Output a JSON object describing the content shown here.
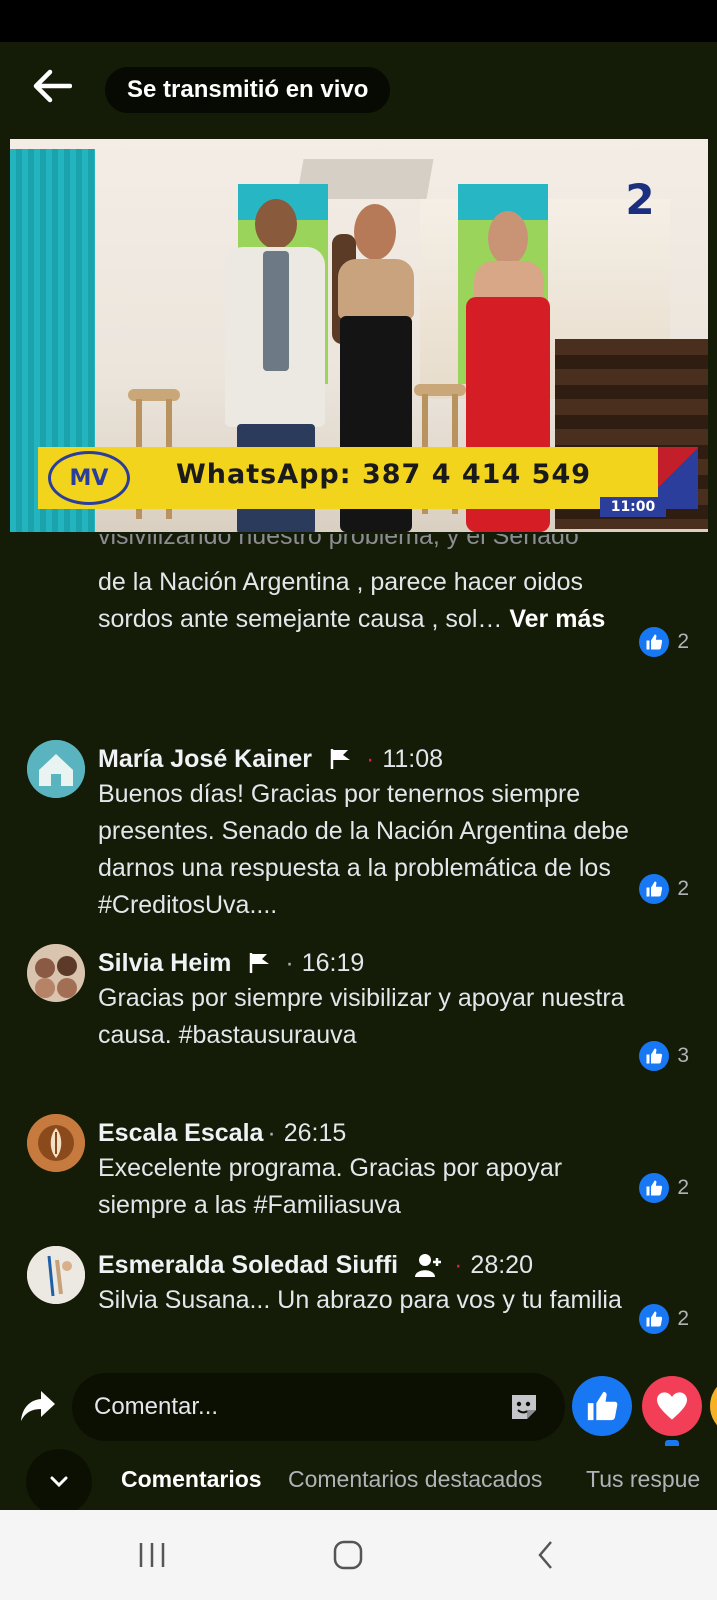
{
  "header": {
    "live_label": "Se transmitió en vivo"
  },
  "video": {
    "banner_logo": "MV",
    "banner_text": "WhatsApp: 387 4 414 549",
    "clock": "11:00",
    "channel": "2"
  },
  "comments": [
    {
      "name": "",
      "time": "",
      "text_faded": "visivilizando nuestro problema, y el Senado",
      "text": "de la Nación Argentina , parece hacer oidos sordos ante semejante causa , sol…",
      "more": "Ver más",
      "likes": "2"
    },
    {
      "name": "María José Kainer",
      "time": "11:08",
      "badge": "flag-icon",
      "text": "Buenos días! Gracias por tenernos siempre presentes. Senado de la Nación Argentina debe darnos una respuesta a la problemática de los #CreditosUva....",
      "likes": "2"
    },
    {
      "name": "Silvia Heim",
      "time": "16:19",
      "badge": "flag-icon",
      "text": "Gracias por siempre visibilizar y apoyar nuestra causa. #bastausurauva",
      "likes": "3"
    },
    {
      "name": "Escala Escala",
      "time": "26:15",
      "text": "Execelente programa. Gracias por apoyar siempre  a las #Familiasuva",
      "likes": "2"
    },
    {
      "name": "Esmeralda Soledad Siuffi",
      "time": "28:20",
      "badge": "new-member-icon",
      "text": "Silvia Susana... Un abrazo para vos y tu familia",
      "likes": "2"
    }
  ],
  "composer": {
    "placeholder": "Comentar..."
  },
  "tabs": [
    {
      "label": "Comentarios",
      "active": true
    },
    {
      "label": "Comentarios destacados",
      "active": false
    },
    {
      "label": "Tus respue",
      "active": false
    }
  ],
  "colors": {
    "background": "#141b06",
    "like_blue": "#1877f2",
    "love_red": "#f33e58",
    "banner_yellow": "#f2d41c"
  }
}
